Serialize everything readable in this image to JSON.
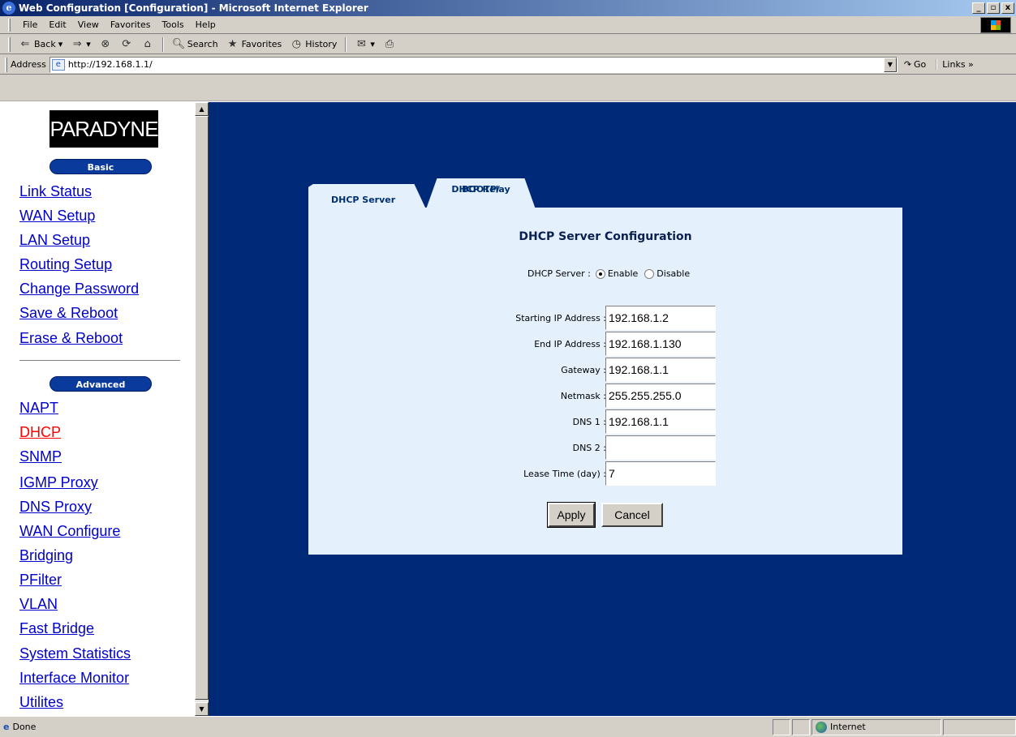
{
  "window": {
    "title": "Web Configuration [Configuration] - Microsoft Internet Explorer",
    "controls": [
      "_",
      "▫",
      "x"
    ]
  },
  "menu": [
    "File",
    "Edit",
    "View",
    "Favorites",
    "Tools",
    "Help"
  ],
  "toolbar": {
    "back": "Back",
    "search": "Search",
    "favorites": "Favorites",
    "history": "History"
  },
  "address": {
    "label": "Address",
    "url": "http://192.168.1.1/",
    "go": "Go",
    "links": "Links »"
  },
  "sidebar": {
    "logo": "PARADYNE",
    "basic_heading": "Basic",
    "basic_links": [
      "Link Status",
      "WAN Setup",
      "LAN Setup",
      "Routing Setup",
      "Change Password",
      "Save & Reboot",
      "Erase & Reboot"
    ],
    "advanced_heading": "Advanced",
    "advanced_links": [
      "NAPT",
      "DHCP",
      "SNMP",
      "IGMP Proxy",
      "DNS Proxy",
      "WAN Configure",
      "Bridging",
      "PFilter",
      "VLAN",
      "Fast Bridge",
      "System Statistics",
      "Interface Monitor",
      "Utilites"
    ],
    "active_link": "DHCP"
  },
  "tabs": {
    "dhcp_server": "DHCP Server",
    "bootp_line1": "BOOTP/",
    "bootp_line2": "DHCP Relay"
  },
  "form": {
    "title": "DHCP Server Configuration",
    "server_label": "DHCP Server :",
    "enable": "Enable",
    "disable": "Disable",
    "selected": "Enable",
    "fields": [
      {
        "label": "Starting IP Address :",
        "value": "192.168.1.2"
      },
      {
        "label": "End IP Address :",
        "value": "192.168.1.130"
      },
      {
        "label": "Gateway :",
        "value": "192.168.1.1"
      },
      {
        "label": "Netmask :",
        "value": "255.255.255.0"
      },
      {
        "label": "DNS 1 :",
        "value": "192.168.1.1"
      },
      {
        "label": "DNS 2 :",
        "value": ""
      },
      {
        "label": "Lease Time (day) :",
        "value": "7"
      }
    ],
    "apply": "Apply",
    "cancel": "Cancel"
  },
  "status": {
    "text": "Done",
    "zone": "Internet"
  }
}
